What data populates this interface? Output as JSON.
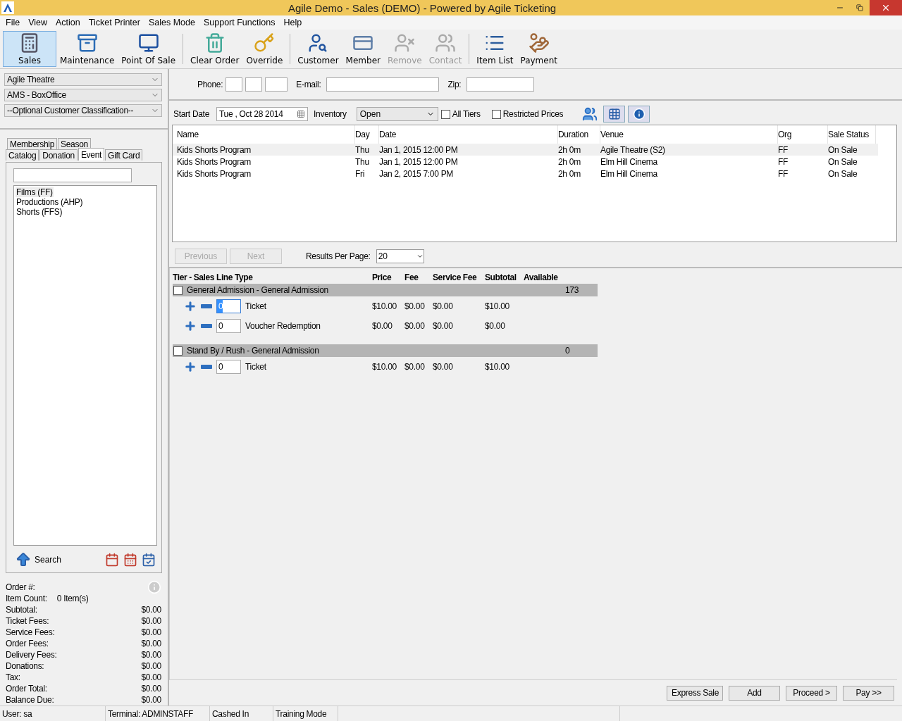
{
  "window": {
    "title": "Agile Demo - Sales (DEMO) - Powered by Agile Ticketing"
  },
  "menu": [
    "File",
    "View",
    "Action",
    "Ticket Printer",
    "Sales Mode",
    "Support Functions",
    "Help"
  ],
  "toolbar": [
    {
      "label": "Sales",
      "kind": "register",
      "selected": true,
      "disabled": false,
      "separator_before": false
    },
    {
      "label": "Maintenance",
      "kind": "cabinet",
      "selected": false,
      "disabled": false,
      "separator_before": false
    },
    {
      "label": "Point Of Sale",
      "kind": "monitor",
      "selected": false,
      "disabled": false,
      "separator_before": false
    },
    {
      "label": "Clear Order",
      "kind": "trash",
      "selected": false,
      "disabled": false,
      "separator_before": true
    },
    {
      "label": "Override",
      "kind": "key",
      "selected": false,
      "disabled": false,
      "separator_before": false
    },
    {
      "label": "Customer",
      "kind": "user-search",
      "selected": false,
      "disabled": false,
      "separator_before": true
    },
    {
      "label": "Member",
      "kind": "card",
      "selected": false,
      "disabled": false,
      "separator_before": false
    },
    {
      "label": "Remove",
      "kind": "user-remove",
      "selected": false,
      "disabled": true,
      "separator_before": false
    },
    {
      "label": "Contact",
      "kind": "users",
      "selected": false,
      "disabled": true,
      "separator_before": false
    },
    {
      "label": "Item List",
      "kind": "list",
      "selected": false,
      "disabled": false,
      "separator_before": true
    },
    {
      "label": "Payment",
      "kind": "hand",
      "selected": false,
      "disabled": false,
      "separator_before": false
    }
  ],
  "sidebar": {
    "selects": [
      "Agile Theatre",
      "AMS - BoxOffice",
      "--Optional Customer Classification--"
    ],
    "tab_rows": [
      [
        {
          "label": "Membership",
          "selected": false
        },
        {
          "label": "Season",
          "selected": false
        }
      ],
      [
        {
          "label": "Catalog",
          "selected": false
        },
        {
          "label": "Donation",
          "selected": false
        },
        {
          "label": "Event",
          "selected": true
        },
        {
          "label": "Gift Card",
          "selected": false
        }
      ]
    ],
    "categories": [
      {
        "label": "Films  (FF)",
        "selected": true
      },
      {
        "label": "Productions  (AHP)",
        "selected": false
      },
      {
        "label": "Shorts  (FFS)",
        "selected": false
      }
    ],
    "search_button": "Search",
    "summary": [
      {
        "label": "Order #:",
        "kind": "info"
      },
      {
        "label": "Item Count:",
        "value": "0 Item(s)",
        "kind": "inline"
      },
      {
        "label": "Subtotal:",
        "value": "$0.00"
      },
      {
        "label": "Ticket Fees:",
        "value": "$0.00"
      },
      {
        "label": "Service Fees:",
        "value": "$0.00"
      },
      {
        "label": "Order Fees:",
        "value": "$0.00"
      },
      {
        "label": "Delivery Fees:",
        "value": "$0.00"
      },
      {
        "label": "Donations:",
        "value": "$0.00"
      },
      {
        "label": "Tax:",
        "value": "$0.00"
      },
      {
        "label": "Order Total:",
        "value": "$0.00"
      },
      {
        "label": "Balance Due:",
        "value": "$0.00"
      }
    ]
  },
  "customer": {
    "phone_label": "Phone:",
    "email_label": "E-mail:",
    "zip_label": "Zip:"
  },
  "filters": {
    "start_date_label": "Start Date",
    "start_date": "Tue , Oct  28 2014",
    "inventory_label": "Inventory",
    "inventory": "Open",
    "all_tiers": {
      "label": "All Tiers",
      "checked": false
    },
    "restricted_prices": {
      "label": "Restricted Prices",
      "checked": false
    }
  },
  "events": {
    "columns": [
      "Name",
      "Day",
      "Date",
      "Duration",
      "Venue",
      "Org",
      "Sale Status"
    ],
    "rows": [
      {
        "cells": [
          "Kids Shorts Program",
          "Thu",
          "Jan 1, 2015 12:00 PM",
          "2h 0m",
          "Agile Theatre (S2)",
          "FF",
          "On Sale"
        ],
        "selected": true
      },
      {
        "cells": [
          "Kids Shorts Program",
          "Thu",
          "Jan 1, 2015 12:00 PM",
          "2h 0m",
          "Elm Hill Cinema",
          "FF",
          "On Sale"
        ],
        "selected": false
      },
      {
        "cells": [
          "Kids Shorts Program",
          "Fri",
          "Jan 2, 2015 7:00 PM",
          "2h 0m",
          "Elm Hill Cinema",
          "FF",
          "On Sale"
        ],
        "selected": false
      }
    ]
  },
  "pager": {
    "previous": {
      "label": "Previous",
      "disabled": true
    },
    "next": {
      "label": "Next",
      "disabled": true
    },
    "per_page_label": "Results Per Page:",
    "per_page": "20"
  },
  "tiers": {
    "columns": [
      "Tier - Sales Line Type",
      "Price",
      "Fee",
      "Service Fee",
      "Subtotal",
      "Available"
    ],
    "groups": [
      {
        "name": "General Admission - General Admission",
        "available": "173",
        "checked": false,
        "lines": [
          {
            "qty": "0",
            "focused": true,
            "name": "Ticket",
            "price": "$10.00",
            "fee": "$0.00",
            "service_fee": "$0.00",
            "subtotal": "$10.00"
          },
          {
            "qty": "0",
            "focused": false,
            "name": "Voucher Redemption",
            "price": "$0.00",
            "fee": "$0.00",
            "service_fee": "$0.00",
            "subtotal": "$0.00"
          }
        ]
      },
      {
        "name": "Stand By / Rush - General Admission",
        "available": "0",
        "checked": false,
        "lines": [
          {
            "qty": "0",
            "focused": false,
            "name": "Ticket",
            "price": "$10.00",
            "fee": "$0.00",
            "service_fee": "$0.00",
            "subtotal": "$10.00"
          }
        ]
      }
    ]
  },
  "actions": [
    "Express Sale",
    "Add",
    "Proceed >",
    "Pay >>"
  ],
  "status_bar": [
    "User:  sa",
    "Terminal: ADMINSTAFF",
    "Cashed In",
    "Training Mode"
  ]
}
